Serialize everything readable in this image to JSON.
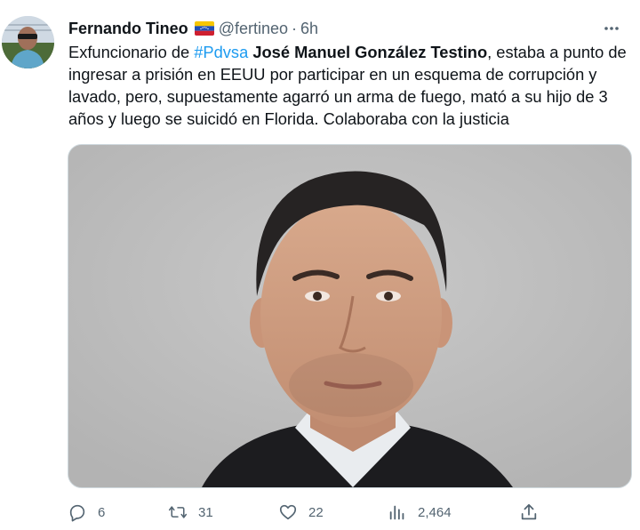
{
  "author": {
    "display_name": "Fernando Tineo",
    "handle": "@fertineo",
    "separator": "·",
    "time": "6h",
    "flag_icon": "venezuela-flag-icon"
  },
  "tweet": {
    "text_prefix": "Exfuncionario de ",
    "hashtag": "#Pdvsa",
    "text_space": " ",
    "bold_name": "José Manuel González Testino",
    "text_rest": ", estaba a punto de ingresar a prisión en EEUU por participar en un esquema de corrupción y lavado, pero, supuestamente agarró un arma de fuego, mató a su hijo de 3 años y luego se suicidó en Florida. Colaboraba con la justicia"
  },
  "actions": {
    "replies": "6",
    "retweets": "31",
    "likes": "22",
    "views": "2,464"
  },
  "colors": {
    "accent": "#1d9bf0",
    "secondary_text": "#536471",
    "primary_text": "#0f1419"
  }
}
